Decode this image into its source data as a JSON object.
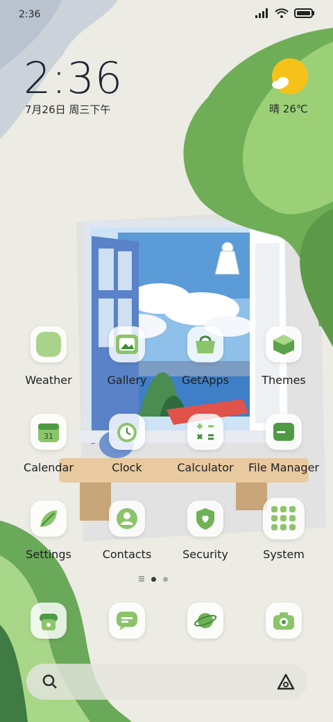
{
  "status_bar": {
    "time": "2:36",
    "icons": [
      "signal-icon",
      "wifi-icon",
      "battery-icon"
    ]
  },
  "clock_widget": {
    "time": "2:36",
    "date": "7月26日 周三下午"
  },
  "weather_widget": {
    "condition": "晴",
    "temperature": "26℃",
    "icon": "sun-cloud-icon"
  },
  "apps": [
    {
      "label": "Weather",
      "icon": "weather-icon"
    },
    {
      "label": "Gallery",
      "icon": "gallery-icon"
    },
    {
      "label": "GetApps",
      "icon": "getapps-icon"
    },
    {
      "label": "Themes",
      "icon": "themes-icon"
    },
    {
      "label": "Calendar",
      "icon": "calendar-icon",
      "badge": "31"
    },
    {
      "label": "Clock",
      "icon": "clock-icon"
    },
    {
      "label": "Calculator",
      "icon": "calculator-icon"
    },
    {
      "label": "File Manager",
      "icon": "file-manager-icon"
    },
    {
      "label": "Settings",
      "icon": "settings-icon"
    },
    {
      "label": "Contacts",
      "icon": "contacts-icon"
    },
    {
      "label": "Security",
      "icon": "security-icon"
    },
    {
      "label": "System",
      "icon": "folder-icon"
    }
  ],
  "dock": [
    {
      "icon": "phone-icon"
    },
    {
      "icon": "messages-icon"
    },
    {
      "icon": "browser-icon"
    },
    {
      "icon": "camera-icon"
    }
  ],
  "pager": {
    "current": 1,
    "count": 2
  },
  "search_bar": {
    "left_icon": "search-icon",
    "right_icon": "assistant-icon"
  },
  "colors": {
    "accent_green": "#8cc46a",
    "dark_green": "#3f8a3b",
    "sun": "#f6c21a"
  }
}
